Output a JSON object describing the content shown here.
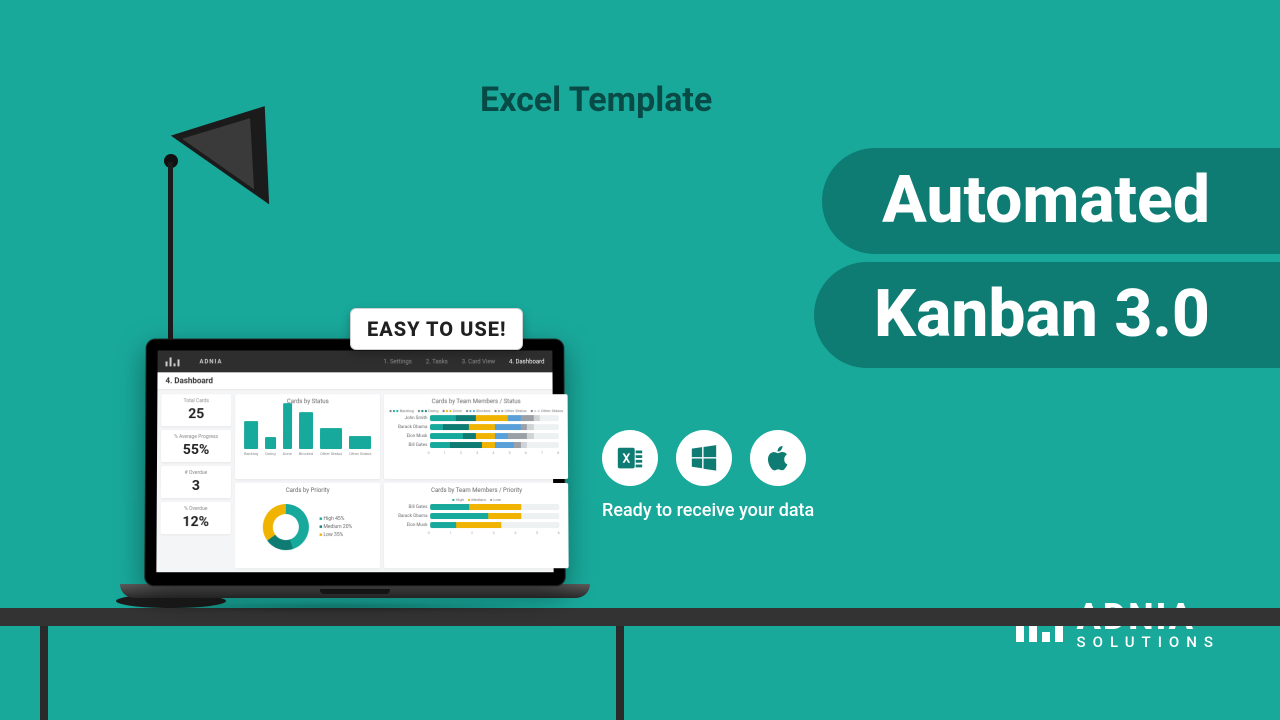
{
  "eyebrow": "Excel Template",
  "title_line1": "Automated",
  "title_line2": "Kanban 3.0",
  "badge": "EASY TO USE!",
  "platform_caption": "Ready to receive your data",
  "brand": {
    "name": "ADNIA",
    "sub": "SOLUTIONS"
  },
  "dashboard": {
    "topbar_brand": "ADNIA",
    "tabs": [
      "1. Settings",
      "2. Tasks",
      "3. Card View",
      "4. Dashboard"
    ],
    "active_tab_index": 3,
    "page_title": "4. Dashboard",
    "kpis": [
      {
        "label": "Total Cards",
        "value": "25"
      },
      {
        "label": "% Average Progress",
        "value": "55%"
      },
      {
        "label": "# Overdue",
        "value": "3"
      },
      {
        "label": "% Overdue",
        "value": "12%"
      }
    ],
    "chart_status": {
      "title": "Cards by Status",
      "categories": [
        "Backlog",
        "Doing",
        "Done",
        "Blocked",
        "Other Status",
        "Other Status"
      ],
      "values": [
        48,
        20,
        78,
        62,
        35,
        22
      ],
      "colors": [
        "#17a99b",
        "#17a99b",
        "#17a99b",
        "#17a99b",
        "#17a99b",
        "#17a99b"
      ]
    },
    "chart_team": {
      "title": "Cards by Team Members / Status",
      "legend": [
        "Backlog",
        "Doing",
        "Done",
        "Blocked",
        "Other Status",
        "Other Status"
      ],
      "legend_colors": [
        "#17a99b",
        "#0e7c73",
        "#f0b400",
        "#5aa0d8",
        "#9aa0a6",
        "#cfd3d6"
      ],
      "rows": [
        {
          "name": "John Smith",
          "segments": [
            20,
            15,
            25,
            10,
            10,
            5
          ]
        },
        {
          "name": "Barack Obama",
          "segments": [
            10,
            20,
            20,
            20,
            5,
            5
          ]
        },
        {
          "name": "Elon Musk",
          "segments": [
            25,
            10,
            15,
            10,
            15,
            5
          ]
        },
        {
          "name": "Bill Gates",
          "segments": [
            15,
            25,
            10,
            15,
            5,
            5
          ]
        }
      ],
      "axis_ticks": [
        "0",
        "1",
        "2",
        "3",
        "4",
        "5",
        "6",
        "7",
        "8"
      ]
    },
    "chart_priority": {
      "title": "Cards by Priority",
      "legend": [
        {
          "label": "High",
          "pct": "45%",
          "color": "#17a99b"
        },
        {
          "label": "Medium",
          "pct": "20%",
          "color": "#0e7c73"
        },
        {
          "label": "Low",
          "pct": "35%",
          "color": "#f0b400"
        }
      ]
    },
    "chart_team_priority": {
      "title": "Cards by Team Members / Priority",
      "legend": [
        "High",
        "Medium",
        "Low"
      ],
      "rows": [
        {
          "name": "Bill Gates",
          "segments": [
            30,
            40
          ]
        },
        {
          "name": "Barack Obama",
          "segments": [
            45,
            25
          ]
        },
        {
          "name": "Elon Musk",
          "segments": [
            20,
            35
          ]
        }
      ],
      "axis_ticks": [
        "0",
        "1",
        "2",
        "3",
        "4",
        "5",
        "6"
      ]
    }
  }
}
